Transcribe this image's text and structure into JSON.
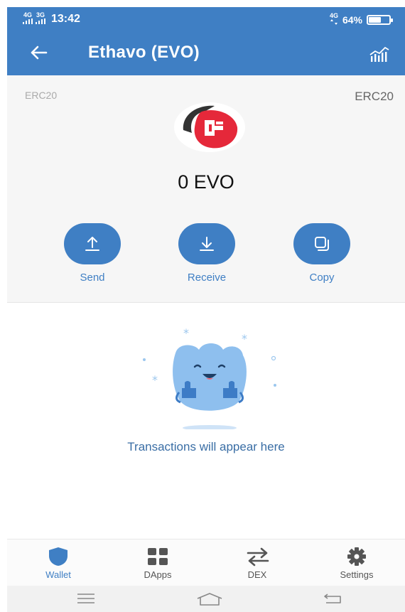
{
  "status_bar": {
    "network1": "4G",
    "network2": "3G",
    "time": "13:42",
    "network_right": "4G",
    "battery_text": "64%",
    "battery_level": 0.64
  },
  "header": {
    "title": "Ethavo (EVO)",
    "back_icon": "arrow-left-icon",
    "chart_icon": "market-chart-icon"
  },
  "token": {
    "standard_left": "ERC20",
    "standard_right": "ERC20",
    "balance": "0 EVO",
    "logo_icon": "ethavo-logo"
  },
  "actions": [
    {
      "label": "Send",
      "icon": "upload-arrow-icon"
    },
    {
      "label": "Receive",
      "icon": "download-arrow-icon"
    },
    {
      "label": "Copy",
      "icon": "copy-icon"
    }
  ],
  "empty_state": {
    "message": "Transactions will appear here",
    "illustration": "happy-mascot-thumbs-up"
  },
  "bottom_nav": [
    {
      "label": "Wallet",
      "icon": "shield-icon",
      "active": true
    },
    {
      "label": "DApps",
      "icon": "grid-icon",
      "active": false
    },
    {
      "label": "DEX",
      "icon": "swap-arrows-icon",
      "active": false
    },
    {
      "label": "Settings",
      "icon": "gear-icon",
      "active": false
    }
  ],
  "system_nav": {
    "menu_icon": "menu-icon",
    "home_icon": "home-icon",
    "back_icon": "back-icon"
  },
  "colors": {
    "primary": "#3f7fc4",
    "logo_red": "#e5283a",
    "logo_dark": "#333333",
    "mascot_blue": "#8ebfee"
  }
}
